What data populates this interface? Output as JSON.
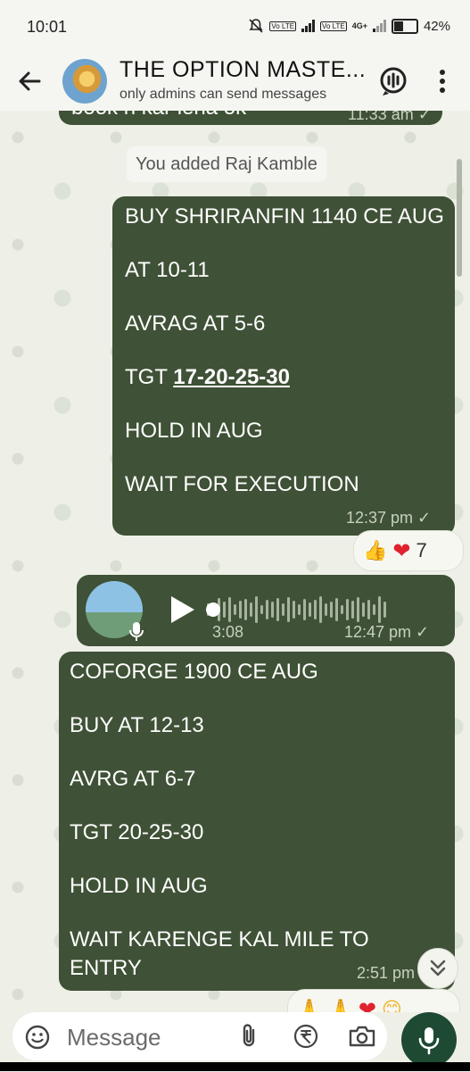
{
  "status_bar": {
    "time": "10:01",
    "net1": "Vo LTE",
    "net2": "Vo LTE",
    "data": "4G+",
    "battery": "42%"
  },
  "header": {
    "title": "THE OPTION MASTE...",
    "subtitle": "only admins can send messages"
  },
  "messages": {
    "partial_text": "book h kar lena ok",
    "partial_time": "11:33 am ✓",
    "system": "You added Raj Kamble",
    "m1": {
      "l1": "BUY SHRIRANFIN 1140 CE AUG",
      "l2": "AT 10-11",
      "l3": "AVRAG AT 5-6",
      "l4_prefix": "TGT ",
      "l4_link": "17-20-25-30",
      "l5": "HOLD IN AUG",
      "l6": "WAIT FOR EXECUTION",
      "time": "12:37 pm ✓",
      "reaction_count": "7"
    },
    "voice": {
      "duration": "3:08",
      "time": "12:47 pm ✓"
    },
    "m2": {
      "l1": "COFORGE 1900 CE AUG",
      "l2": "BUY AT 12-13",
      "l3": "AVRG AT 6-7",
      "l4": "TGT 20-25-30",
      "l5": "HOLD IN AUG",
      "l6": "WAIT KARENGE KAL MILE TO",
      "l7": "ENTRY",
      "time": "2:51 pm"
    }
  },
  "input": {
    "placeholder": "Message"
  },
  "colors": {
    "bubble": "#3f5136",
    "accent": "#1e4a33",
    "heart": "#e0242f"
  }
}
